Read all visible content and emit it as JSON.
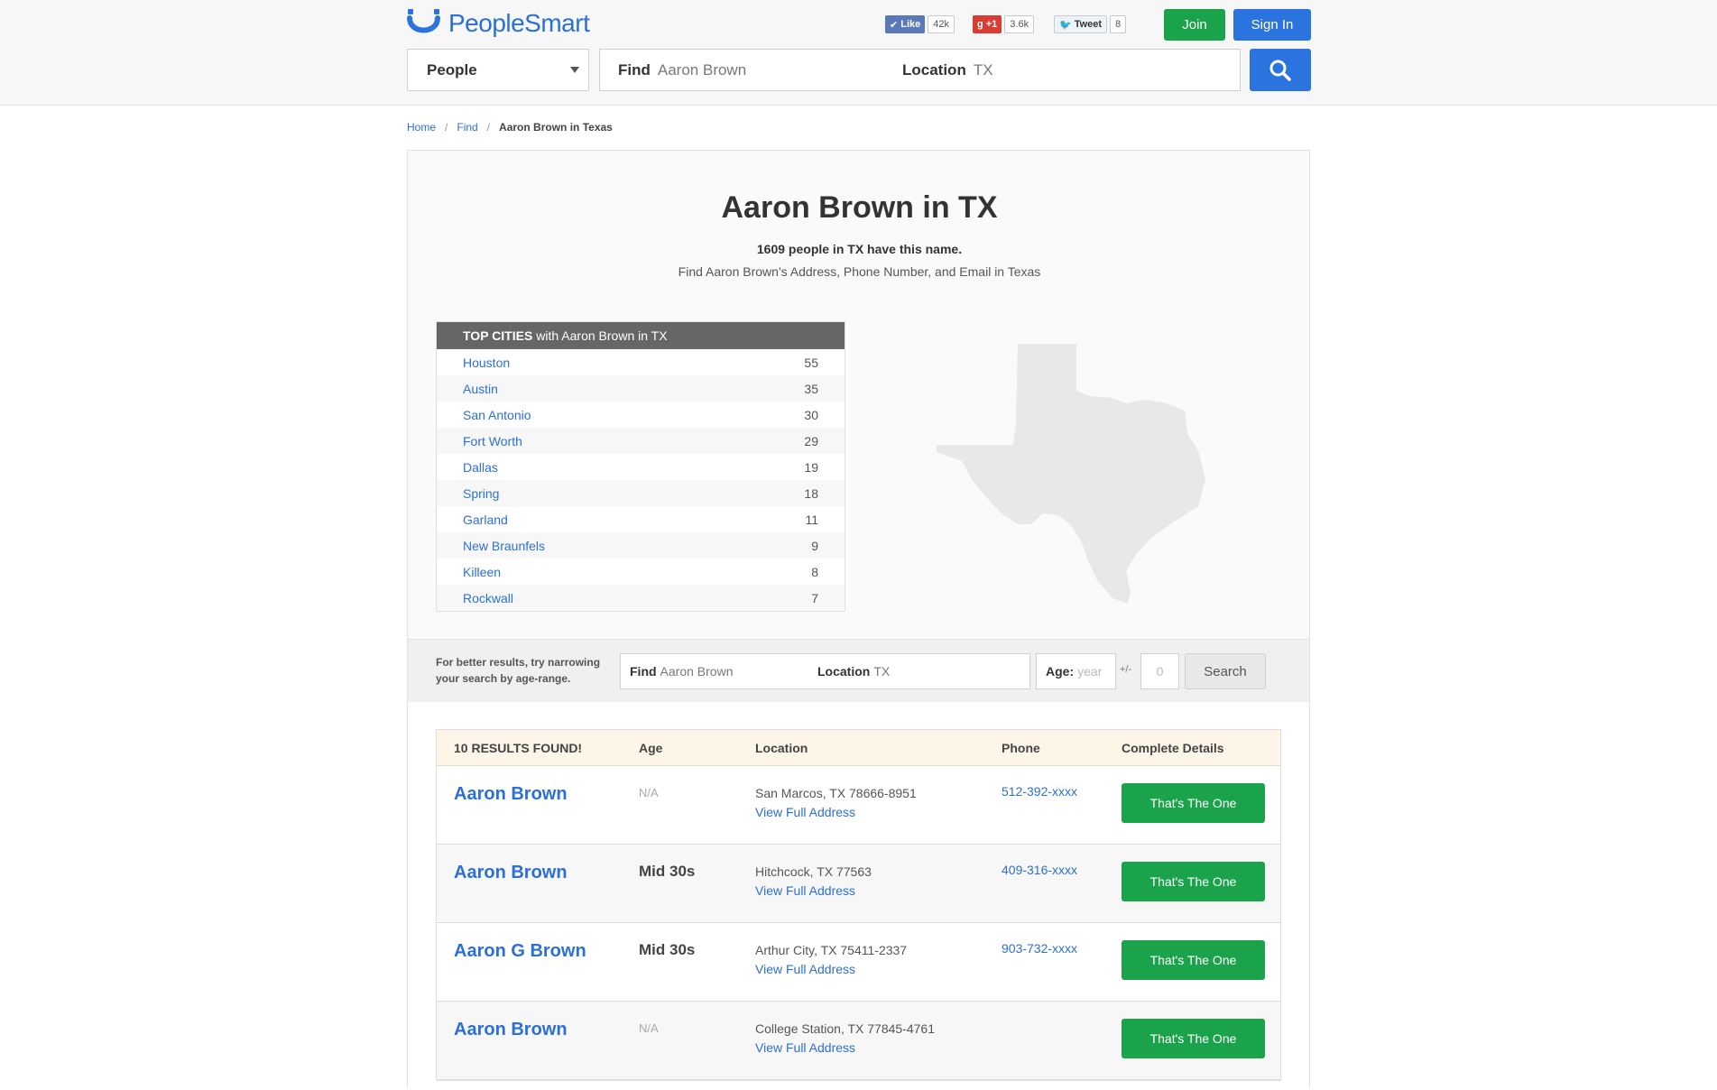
{
  "brand": {
    "name": "PeopleSmart"
  },
  "social": {
    "like_label": "Like",
    "like_count": "42k",
    "gplus_label": "+1",
    "gplus_count": "3.6k",
    "tweet_label": "Tweet",
    "tweet_count": "8"
  },
  "header": {
    "join_label": "Join",
    "signin_label": "Sign In",
    "category_selected": "People",
    "find_label": "Find",
    "find_value": "Aaron Brown",
    "location_label": "Location",
    "location_value": "TX"
  },
  "breadcrumb": {
    "home": "Home",
    "find": "Find",
    "current": "Aaron Brown in Texas"
  },
  "page": {
    "title": "Aaron Brown in TX",
    "count_text": "1609 people in TX have this name.",
    "subtitle": "Find Aaron Brown's Address, Phone Number, and Email in Texas"
  },
  "top_cities": {
    "head_bold": "TOP CITIES",
    "head_rest": "with Aaron Brown in TX",
    "rows": [
      {
        "city": "Houston",
        "count": "55"
      },
      {
        "city": "Austin",
        "count": "35"
      },
      {
        "city": "San Antonio",
        "count": "30"
      },
      {
        "city": "Fort Worth",
        "count": "29"
      },
      {
        "city": "Dallas",
        "count": "19"
      },
      {
        "city": "Spring",
        "count": "18"
      },
      {
        "city": "Garland",
        "count": "11"
      },
      {
        "city": "New Braunfels",
        "count": "9"
      },
      {
        "city": "Killeen",
        "count": "8"
      },
      {
        "city": "Rockwall",
        "count": "7"
      }
    ]
  },
  "narrow": {
    "text": "For better results, try narrowing your search by age-range.",
    "find_label": "Find",
    "find_value": "Aaron Brown",
    "location_label": "Location",
    "location_value": "TX",
    "age_label": "Age:",
    "age_placeholder": "year",
    "plusminus": "+/-",
    "range_placeholder": "0",
    "search_label": "Search"
  },
  "results": {
    "columns": [
      "10 RESULTS FOUND!",
      "Age",
      "Location",
      "Phone",
      "Complete Details"
    ],
    "rows": [
      {
        "name": "Aaron Brown",
        "age": "N/A",
        "location": "San Marcos, TX 78666-8951",
        "address_link": "View Full Address",
        "phone": "512-392-xxxx",
        "button": "That's The One"
      },
      {
        "name": "Aaron Brown",
        "age": "Mid 30s",
        "location": "Hitchcock, TX 77563",
        "address_link": "View Full Address",
        "phone": "409-316-xxxx",
        "button": "That's The One"
      },
      {
        "name": "Aaron G Brown",
        "age": "Mid 30s",
        "location": "Arthur City, TX 75411-2337",
        "address_link": "View Full Address",
        "phone": "903-732-xxxx",
        "button": "That's The One"
      },
      {
        "name": "Aaron Brown",
        "age": "N/A",
        "location": "College Station, TX 77845-4761",
        "address_link": "View Full Address",
        "phone": "",
        "button": "That's The One"
      }
    ]
  },
  "colors": {
    "brand_blue": "#2b74e0",
    "green": "#1aa34a",
    "link": "#2b6fd8"
  }
}
